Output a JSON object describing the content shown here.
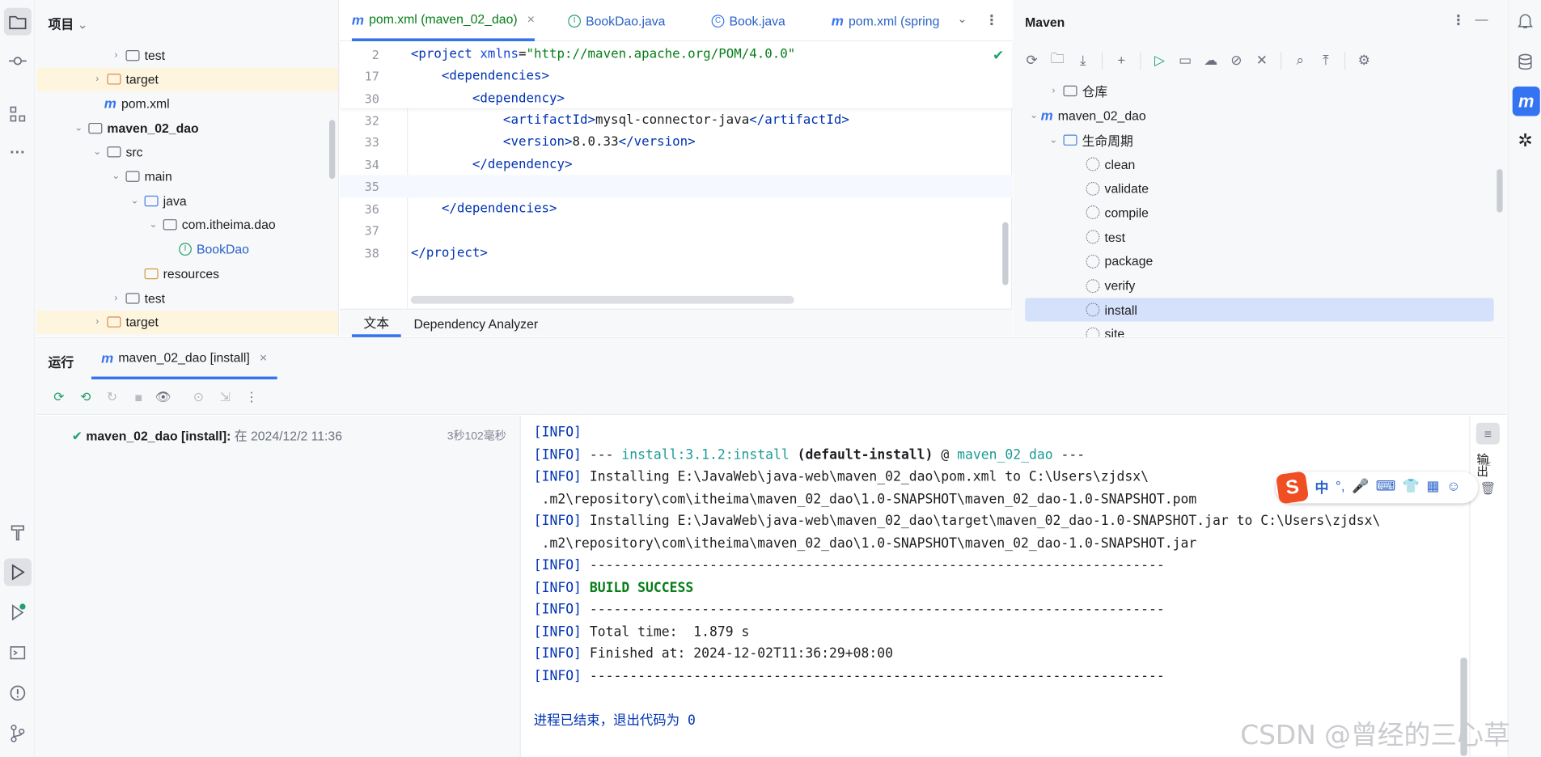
{
  "project": {
    "title": "项目",
    "tree": [
      {
        "label": "test",
        "indent": 4,
        "chev": "›",
        "icon": "folder",
        "highlight": false
      },
      {
        "label": "target",
        "indent": 3,
        "chev": "›",
        "icon": "folder-orange",
        "highlight": true
      },
      {
        "label": "pom.xml",
        "indent": 3,
        "chev": "",
        "icon": "maven",
        "highlight": false
      },
      {
        "label": "maven_02_dao",
        "indent": 2,
        "chev": "⌄",
        "icon": "module",
        "highlight": false,
        "bold": true
      },
      {
        "label": "src",
        "indent": 3,
        "chev": "⌄",
        "icon": "folder",
        "highlight": false
      },
      {
        "label": "main",
        "indent": 4,
        "chev": "⌄",
        "icon": "folder",
        "highlight": false
      },
      {
        "label": "java",
        "indent": 5,
        "chev": "⌄",
        "icon": "folder-blue",
        "highlight": false
      },
      {
        "label": "com.itheima.dao",
        "indent": 6,
        "chev": "⌄",
        "icon": "package",
        "highlight": false
      },
      {
        "label": "BookDao",
        "indent": 7,
        "chev": "",
        "icon": "interface",
        "highlight": false,
        "color": "#2b63c8"
      },
      {
        "label": "resources",
        "indent": 5,
        "chev": "",
        "icon": "resources",
        "highlight": false
      },
      {
        "label": "test",
        "indent": 4,
        "chev": "›",
        "icon": "folder",
        "highlight": false
      },
      {
        "label": "target",
        "indent": 3,
        "chev": "›",
        "icon": "folder-orange",
        "highlight": true
      }
    ]
  },
  "editor": {
    "tabs": [
      {
        "label": "pom.xml (maven_02_dao)",
        "active": true,
        "icon": "m"
      },
      {
        "label": "BookDao.java",
        "active": false,
        "icon": "I"
      },
      {
        "label": "Book.java",
        "active": false,
        "icon": "C"
      },
      {
        "label": "pom.xml (spring",
        "active": false,
        "icon": "m"
      }
    ],
    "lines": [
      {
        "n": "2",
        "html": "<span class=\"tg\">&lt;project</span> <span class=\"at\">xmlns</span>=<span class=\"str\">\"http://maven.apache.org/POM/4.0.0\"</span>"
      },
      {
        "n": "17",
        "html": "    <span class=\"tg\">&lt;dependencies&gt;</span>"
      },
      {
        "n": "30",
        "html": "        <span class=\"tg\">&lt;dependency&gt;</span>"
      },
      {
        "n": "32",
        "html": "            <span class=\"tg\">&lt;artifactId&gt;</span>mysql-connector-java<span class=\"tg\">&lt;/artifactId&gt;</span>"
      },
      {
        "n": "33",
        "html": "            <span class=\"tg\">&lt;version&gt;</span>8.0.33<span class=\"tg\">&lt;/version&gt;</span>"
      },
      {
        "n": "34",
        "html": "        <span class=\"tg\">&lt;/dependency&gt;</span>"
      },
      {
        "n": "35",
        "html": ""
      },
      {
        "n": "36",
        "html": "    <span class=\"tg\">&lt;/dependencies&gt;</span>"
      },
      {
        "n": "37",
        "html": ""
      },
      {
        "n": "38",
        "html": "<span class=\"tg\">&lt;/project&gt;</span>"
      }
    ],
    "bottom_tabs": [
      "文本",
      "Dependency Analyzer"
    ]
  },
  "maven": {
    "title": "Maven",
    "repo": "仓库",
    "module": "maven_02_dao",
    "lifecycle": "生命周期",
    "phases": [
      "clean",
      "validate",
      "compile",
      "test",
      "package",
      "verify",
      "install",
      "site"
    ],
    "selected": "install"
  },
  "run": {
    "label": "运行",
    "tab": "maven_02_dao [install]",
    "item_bold": "maven_02_dao [install]:",
    "item_time": " 在 2024/12/2 11:36",
    "item_duration": "3秒102毫秒"
  },
  "console": {
    "lines": [
      {
        "parts": [
          [
            "info",
            "[INFO]"
          ]
        ]
      },
      {
        "parts": [
          [
            "info",
            "[INFO]"
          ],
          [
            "",
            " --- "
          ],
          [
            "teal",
            "install:3.1.2:install"
          ],
          [
            "b",
            " (default-install)"
          ],
          [
            "",
            " @ "
          ],
          [
            "teal",
            "maven_02_dao"
          ],
          [
            "",
            " ---"
          ]
        ]
      },
      {
        "parts": [
          [
            "info",
            "[INFO]"
          ],
          [
            "",
            " Installing E:\\JavaWeb\\java-web\\maven_02_dao\\pom.xml to C:\\Users\\zjdsx\\"
          ]
        ]
      },
      {
        "parts": [
          [
            "",
            " .m2\\repository\\com\\itheima\\maven_02_dao\\1.0-SNAPSHOT\\maven_02_dao-1.0-SNAPSHOT.pom"
          ]
        ]
      },
      {
        "parts": [
          [
            "info",
            "[INFO]"
          ],
          [
            "",
            " Installing E:\\JavaWeb\\java-web\\maven_02_dao\\target\\maven_02_dao-1.0-SNAPSHOT.jar to C:\\Users\\zjdsx\\"
          ]
        ]
      },
      {
        "parts": [
          [
            "",
            " .m2\\repository\\com\\itheima\\maven_02_dao\\1.0-SNAPSHOT\\maven_02_dao-1.0-SNAPSHOT.jar"
          ]
        ]
      },
      {
        "parts": [
          [
            "info",
            "[INFO]"
          ],
          [
            "",
            " ------------------------------------------------------------------------"
          ]
        ]
      },
      {
        "parts": [
          [
            "info",
            "[INFO]"
          ],
          [
            "",
            " "
          ],
          [
            "succ",
            "BUILD SUCCESS"
          ]
        ]
      },
      {
        "parts": [
          [
            "info",
            "[INFO]"
          ],
          [
            "",
            " ------------------------------------------------------------------------"
          ]
        ]
      },
      {
        "parts": [
          [
            "info",
            "[INFO]"
          ],
          [
            "",
            " Total time:  1.879 s"
          ]
        ]
      },
      {
        "parts": [
          [
            "info",
            "[INFO]"
          ],
          [
            "",
            " Finished at: 2024-12-02T11:36:29+08:00"
          ]
        ]
      },
      {
        "parts": [
          [
            "info",
            "[INFO]"
          ],
          [
            "",
            " ------------------------------------------------------------------------"
          ]
        ]
      },
      {
        "parts": [
          [
            "",
            ""
          ]
        ]
      },
      {
        "parts": [
          [
            "info",
            "进程已结束，退出代码为 0"
          ]
        ]
      }
    ]
  },
  "ime": {
    "items": [
      "中",
      "°,",
      "🎤",
      "⌨",
      "👕",
      "▦",
      "☺"
    ]
  },
  "watermark": "CSDN @曾经的三心草",
  "side_label": "输出"
}
